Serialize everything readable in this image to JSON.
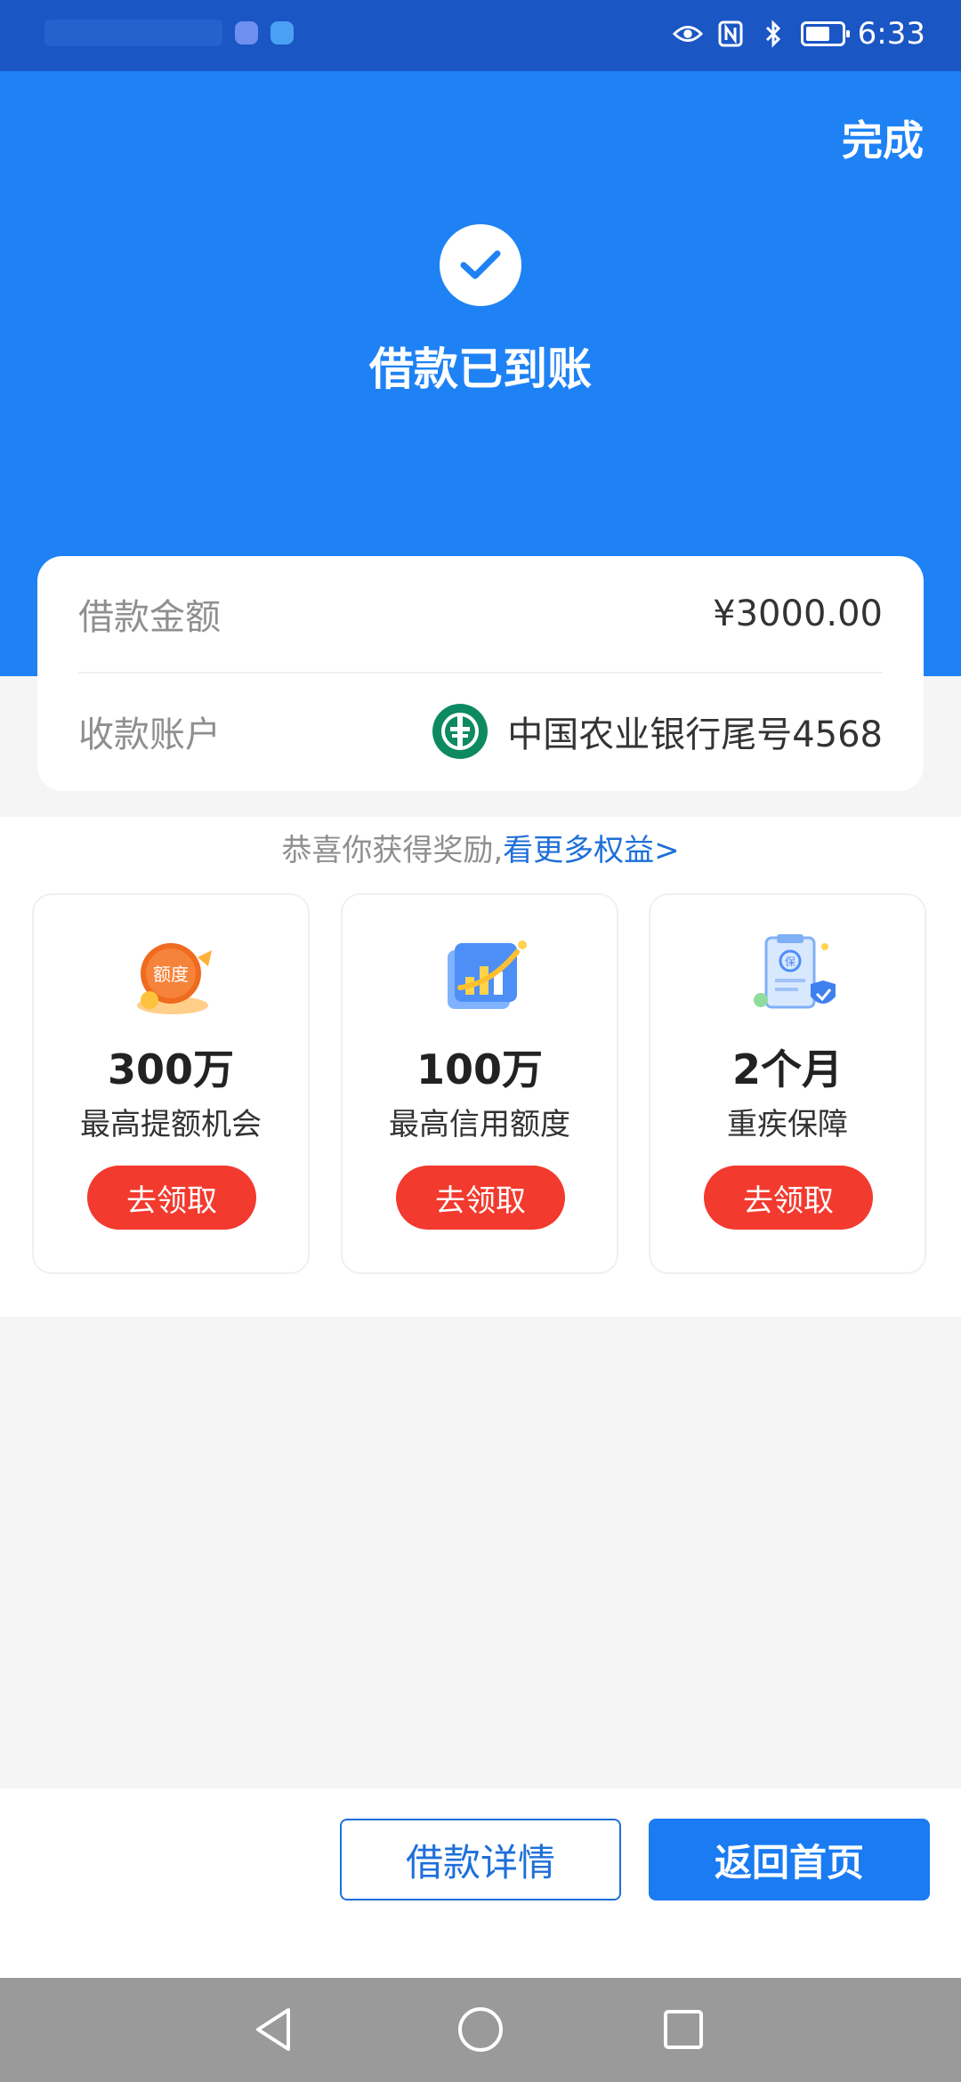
{
  "status_bar": {
    "time": "6:33",
    "icons": [
      "eye-icon",
      "nfc-icon",
      "bluetooth-icon",
      "battery-icon"
    ]
  },
  "header": {
    "done_label": "完成",
    "title": "借款已到账",
    "status_icon": "check-icon",
    "colors": {
      "primary": "#1e82f5",
      "statusbar": "#1a56c4"
    }
  },
  "loan_info": {
    "amount_label": "借款金额",
    "amount_value": "¥3000.00",
    "account_label": "收款账户",
    "account_value": "中国农业银行尾号4568",
    "bank_icon": "abc-bank-logo"
  },
  "rewards": {
    "intro_text": "恭喜你获得奖励,",
    "intro_link": "看更多权益>",
    "items": [
      {
        "icon": "credit-limit-icon",
        "amount": "300万",
        "desc": "最高提额机会",
        "button": "去领取"
      },
      {
        "icon": "credit-chart-icon",
        "amount": "100万",
        "desc": "最高信用额度",
        "button": "去领取"
      },
      {
        "icon": "insurance-shield-icon",
        "amount": "2个月",
        "desc": "重疾保障",
        "button": "去领取"
      }
    ],
    "button_color": "#f23a2e"
  },
  "footer": {
    "details_button": "借款详情",
    "home_button": "返回首页"
  },
  "nav_bar": {
    "icons": [
      "back-icon",
      "home-icon",
      "recent-apps-icon"
    ]
  }
}
